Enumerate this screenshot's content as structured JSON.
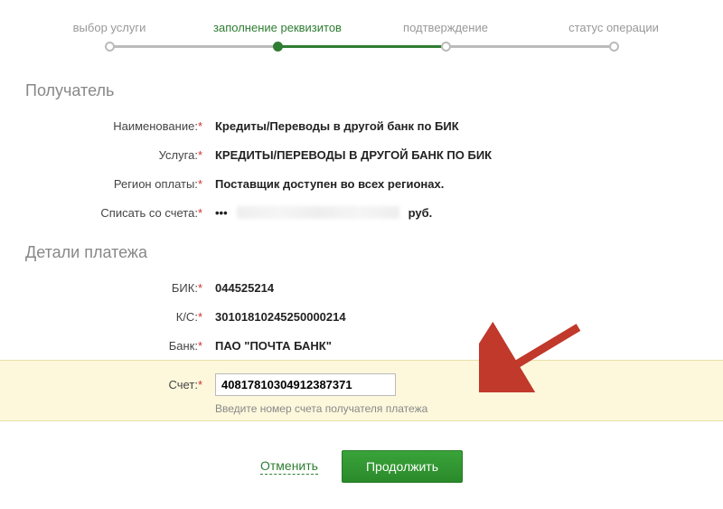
{
  "stepper": {
    "steps": [
      {
        "label": "выбор услуги"
      },
      {
        "label": "заполнение реквизитов"
      },
      {
        "label": "подтверждение"
      },
      {
        "label": "статус операции"
      }
    ]
  },
  "sections": {
    "recipient_title": "Получатель",
    "payment_details_title": "Детали платежа"
  },
  "recipient": {
    "name_label": "Наименование:",
    "name_value": "Кредиты/Переводы в другой банк по БИК",
    "service_label": "Услуга:",
    "service_value": "КРЕДИТЫ/ПЕРЕВОДЫ В ДРУГОЙ БАНК ПО БИК",
    "region_label": "Регион оплаты:",
    "region_value": "Поставщик доступен во всех регионах.",
    "debit_label": "Списать со счета:",
    "debit_masked": "•••",
    "debit_currency": "руб."
  },
  "details": {
    "bik_label": "БИК:",
    "bik_value": "044525214",
    "ks_label": "К/С:",
    "ks_value": "30101810245250000214",
    "bank_label": "Банк:",
    "bank_value": "ПАО \"ПОЧТА БАНК\"",
    "account_label": "Счет:",
    "account_value": "40817810304912387371",
    "account_hint": "Введите номер счета получателя платежа"
  },
  "actions": {
    "cancel": "Отменить",
    "continue": "Продолжить"
  }
}
